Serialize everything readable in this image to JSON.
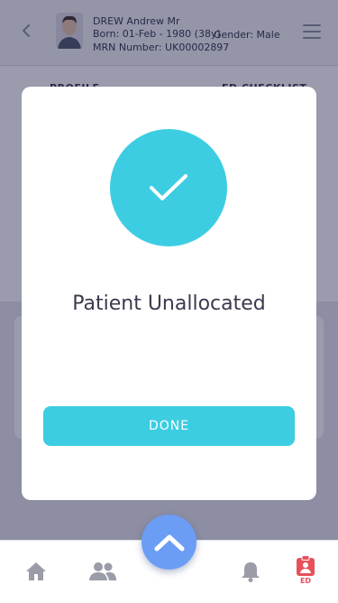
{
  "header": {
    "patient_name": "DREW Andrew Mr",
    "born": "Born: 01-Feb - 1980 (38y)",
    "gender": "Gender: Male",
    "mrn": "MRN Number: UK00002897"
  },
  "tabs": {
    "left_label": "PROFILE",
    "right_label": "ED CHECKLIST"
  },
  "modal": {
    "title": "Patient Unallocated",
    "done_label": "DONE"
  },
  "bottom_nav": {
    "ed_label": "ED"
  },
  "colors": {
    "accent": "#3ccde2",
    "fab": "#6b9df5",
    "alert": "#e8515a",
    "icon_gray": "#9a9ca8"
  },
  "icons": {
    "back": "chevron-left-icon",
    "menu": "hamburger-menu-icon",
    "check": "checkmark-icon",
    "home": "home-icon",
    "people": "people-icon",
    "fab": "chevron-up-icon",
    "bell": "bell-icon",
    "ed": "ed-clipboard-icon"
  }
}
